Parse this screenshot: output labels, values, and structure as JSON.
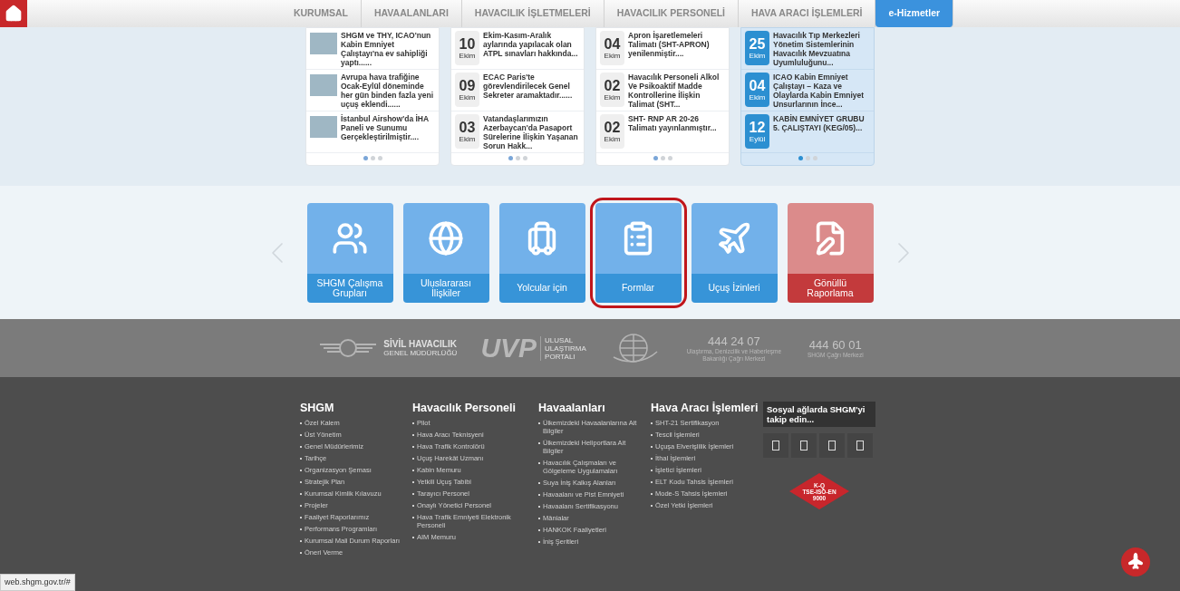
{
  "nav": {
    "items": [
      {
        "label": "KURUMSAL",
        "selected": false
      },
      {
        "label": "HAVAALANLARI",
        "selected": false
      },
      {
        "label": "HAVACILIK İŞLETMELERİ",
        "selected": false
      },
      {
        "label": "HAVACILIK PERSONELİ",
        "selected": false
      },
      {
        "label": "HAVA ARACI İŞLEMLERİ",
        "selected": false
      },
      {
        "label": "e-Hizmetler",
        "selected": true
      }
    ]
  },
  "news_columns": [
    {
      "kind": "thumbnail",
      "highlighted": false,
      "items": [
        {
          "text": "SHGM ve THY, ICAO'nun Kabin Emniyet Çalıştayı'na ev sahipliği yaptı......"
        },
        {
          "text": "Avrupa hava trafiğine Ocak-Eylül döneminde her gün binden fazla yeni uçuş eklendi......"
        },
        {
          "text": "İstanbul Airshow'da İHA Paneli ve Sunumu Gerçekleştirilmiştir...."
        }
      ],
      "dots": [
        {
          "selected": true
        },
        {
          "selected": false
        },
        {
          "selected": false
        }
      ]
    },
    {
      "kind": "dated",
      "highlighted": false,
      "items": [
        {
          "day": "10",
          "month": "Ekim",
          "text": "Ekim-Kasım-Aralık aylarında yapılacak olan ATPL sınavları hakkında..."
        },
        {
          "day": "09",
          "month": "Ekim",
          "text": "ECAC Paris'te görevlendirilecek Genel Sekreter aramaktadır......"
        },
        {
          "day": "03",
          "month": "Ekim",
          "text": "Vatandaşlarımızın Azerbaycan'da Pasaport Sürelerine İlişkin Yaşanan Sorun Hakk..."
        }
      ],
      "dots": [
        {
          "selected": true
        },
        {
          "selected": false
        },
        {
          "selected": false
        }
      ]
    },
    {
      "kind": "dated",
      "highlighted": false,
      "items": [
        {
          "day": "04",
          "month": "Ekim",
          "text": "Apron İşaretlemeleri Talimatı (SHT-APRON) yenilenmiştir...."
        },
        {
          "day": "02",
          "month": "Ekim",
          "text": "Havacılık Personeli Alkol Ve Psikoaktif Madde Kontrollerine İlişkin Talimat (SHT..."
        },
        {
          "day": "02",
          "month": "Ekim",
          "text": "SHT- RNP AR 20-26 Talimatı yayınlanmıştır..."
        }
      ],
      "dots": [
        {
          "selected": true
        },
        {
          "selected": false
        },
        {
          "selected": false
        }
      ]
    },
    {
      "kind": "dated",
      "highlighted": true,
      "items": [
        {
          "day": "25",
          "month": "Ekim",
          "text": "Havacılık Tıp Merkezleri Yönetim Sistemlerinin Havacılık Mevzuatına Uyumluluğunu..."
        },
        {
          "day": "04",
          "month": "Ekim",
          "text": "ICAO Kabin Emniyet Çalıştayı – Kaza ve Olaylarda Kabin Emniyet Unsurlarının İnce..."
        },
        {
          "day": "12",
          "month": "Eylül",
          "text": "KABİN EMNİYET GRUBU 5. ÇALIŞTAYI (KEG/05)..."
        }
      ],
      "dots": [
        {
          "selected": true
        },
        {
          "selected": false
        },
        {
          "selected": false
        }
      ]
    }
  ],
  "tiles": [
    {
      "label": "SHGM Çalışma Grupları",
      "outlined": false
    },
    {
      "label": "Uluslararası İlişkiler",
      "outlined": false
    },
    {
      "label": "Yolcular için",
      "outlined": false
    },
    {
      "label": "Formlar",
      "outlined": true
    },
    {
      "label": "Uçuş İzinleri",
      "outlined": false
    },
    {
      "label": "Gönüllü Raporlama",
      "outlined": false
    }
  ],
  "logos": {
    "shgm_line1": "SİVİL HAVACILIK",
    "shgm_line2": "GENEL MÜDÜRLÜĞÜ",
    "uvp_mark": "UVP",
    "uvp_lines": [
      "ULUSAL",
      "ULAŞTIRMA",
      "PORTALI"
    ],
    "phones": [
      {
        "number": "444 24 07",
        "caption": "Ulaştırma, Denizcilik ve Haberleşme Bakanlığı Çağrı Merkezi"
      },
      {
        "number": "444 60 01",
        "caption": "SHGM Çağrı Merkezi"
      }
    ]
  },
  "footer": {
    "columns": [
      {
        "heading": "SHGM",
        "items": [
          "Özel Kalem",
          "Üst Yönetim",
          "Genel Müdürlerimiz",
          "Tarihçe",
          "Organizasyon Şeması",
          "Stratejik Plan",
          "Kurumsal Kimlik Kılavuzu",
          "Projeler",
          "Faaliyet Raporlarımız",
          "Performans Programları",
          "Kurumsal Mali Durum Raporları",
          "Öneri Verme"
        ]
      },
      {
        "heading": "Havacılık Personeli",
        "items": [
          "Pilot",
          "Hava Aracı Teknisyeni",
          "Hava Trafik Kontrolörü",
          "Uçuş Harekât Uzmanı",
          "Kabin Memuru",
          "Yetkili Uçuş Tabibi",
          "Tarayıcı Personel",
          "Onaylı Yönetici Personel",
          "Hava Trafik Emniyeti Elektronik Personeli",
          "AIM Memuru"
        ]
      },
      {
        "heading": "Havaalanları",
        "items": [
          "Ülkemizdeki Havaalanlarına Ait Bilgiler",
          "Ülkemizdeki Heliportlara Ait Bilgiler",
          "Havacılık Çalışmaları ve Gölgeleme Uygulamaları",
          "Suya İniş Kalkış Alanları",
          "Havaalanı ve Pist Emniyeti",
          "Havaalanı Sertifikasyonu",
          "Mânialar",
          "HANKOK Faaliyetleri",
          "İniş Şeritleri"
        ]
      },
      {
        "heading": "Hava Aracı İşlemleri",
        "items": [
          "SHT-21 Sertifikasyon",
          "Tescil İşlemleri",
          "Uçuşa Elverişlilik İşlemleri",
          "İthal İşlemleri",
          "İşletici İşlemleri",
          "ELT Kodu Tahsis İşlemleri",
          "Mode-S Tahsis İşlemleri",
          "Özel Yetki İşlemleri"
        ]
      }
    ],
    "social_title": "Sosyal ağlarda SHGM'yi takip edin...",
    "badge": [
      "K-Q",
      "TSE-ISO-EN",
      "9000"
    ]
  },
  "status_url": "web.shgm.gov.tr/#"
}
